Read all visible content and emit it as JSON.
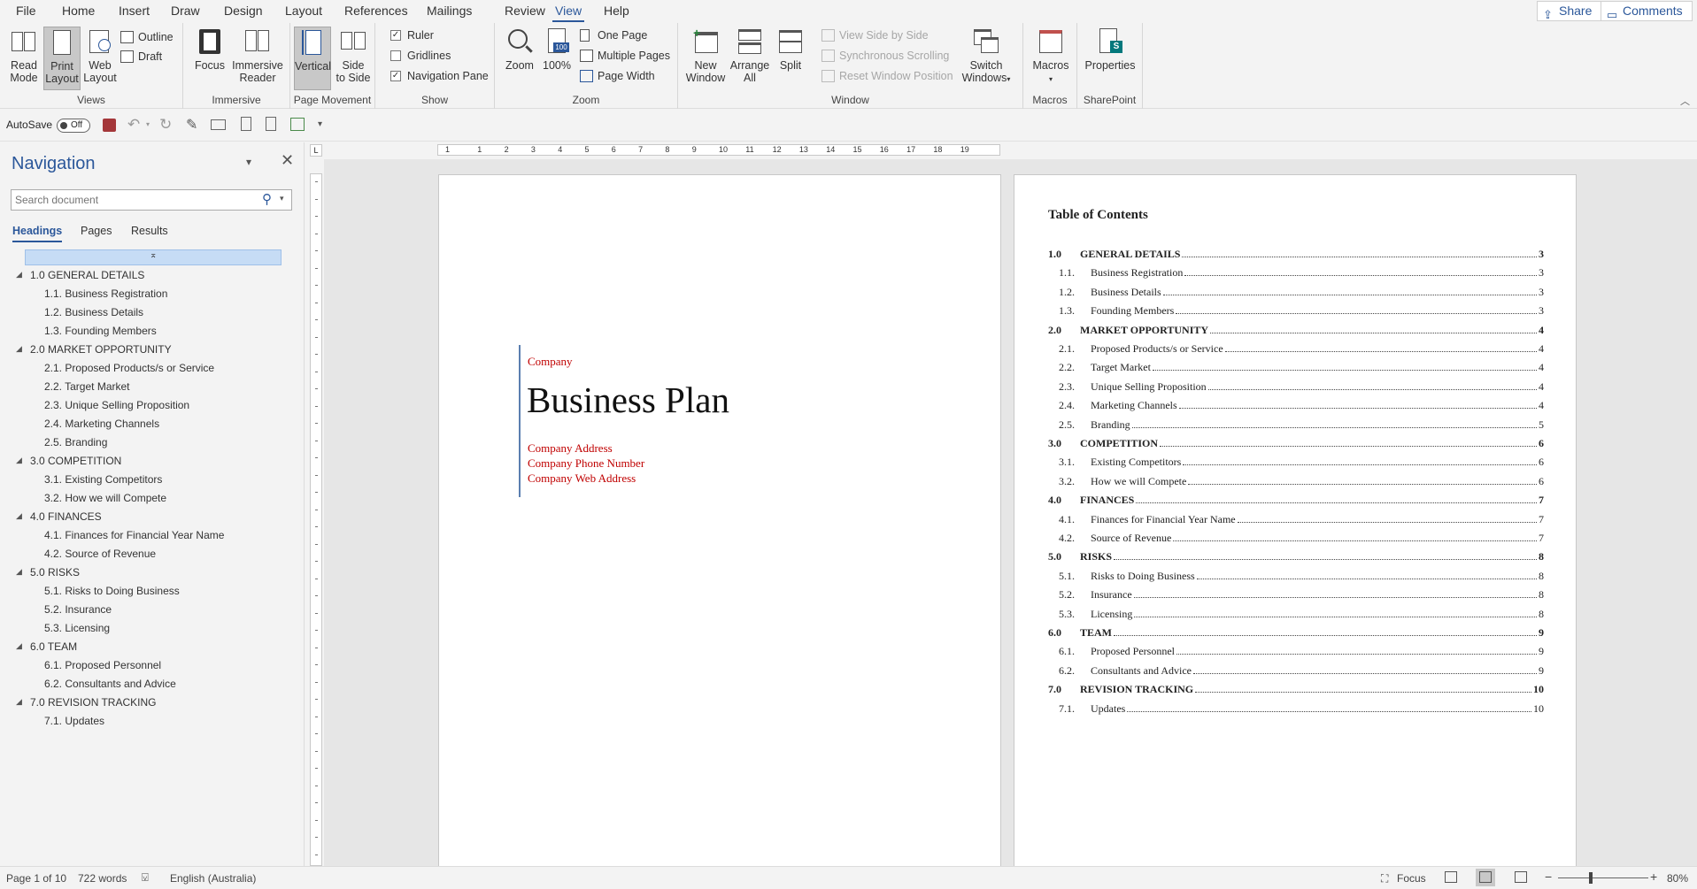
{
  "ribbon_tabs": [
    "File",
    "Home",
    "Insert",
    "Draw",
    "Design",
    "Layout",
    "References",
    "Mailings",
    "Review",
    "View",
    "Help"
  ],
  "active_tab": "View",
  "share": "Share",
  "comments": "Comments",
  "views": {
    "read": "Read\nMode",
    "print": "Print\nLayout",
    "web": "Web\nLayout",
    "outline": "Outline",
    "draft": "Draft",
    "label": "Views"
  },
  "immersive": {
    "focus": "Focus",
    "reader": "Immersive\nReader",
    "label": "Immersive"
  },
  "page_movement": {
    "vertical": "Vertical",
    "side": "Side\nto Side",
    "label": "Page Movement"
  },
  "show": {
    "ruler": "Ruler",
    "gridlines": "Gridlines",
    "nav_pane": "Navigation Pane",
    "label": "Show"
  },
  "zoom": {
    "zoom": "Zoom",
    "hundred": "100%",
    "one_page": "One Page",
    "multiple": "Multiple Pages",
    "width": "Page Width",
    "label": "Zoom"
  },
  "window": {
    "new": "New\nWindow",
    "arrange": "Arrange\nAll",
    "split": "Split",
    "side_by_side": "View Side by Side",
    "sync": "Synchronous Scrolling",
    "reset": "Reset Window Position",
    "switch": "Switch\nWindows",
    "label": "Window"
  },
  "macros": {
    "btn": "Macros",
    "label": "Macros"
  },
  "sharepoint": {
    "btn": "Properties",
    "label": "SharePoint"
  },
  "autosave": "AutoSave",
  "autosave_state": "Off",
  "nav": {
    "title": "Navigation",
    "search_placeholder": "Search document",
    "tabs": [
      "Headings",
      "Pages",
      "Results"
    ],
    "headings": [
      {
        "text": "1.0 GENERAL DETAILS",
        "level": 1
      },
      {
        "text": "1.1. Business Registration",
        "level": 2
      },
      {
        "text": "1.2. Business Details",
        "level": 2
      },
      {
        "text": "1.3. Founding Members",
        "level": 2
      },
      {
        "text": "2.0 MARKET OPPORTUNITY",
        "level": 1
      },
      {
        "text": "2.1. Proposed Products/s or Service",
        "level": 2
      },
      {
        "text": "2.2. Target Market",
        "level": 2
      },
      {
        "text": "2.3. Unique Selling Proposition",
        "level": 2
      },
      {
        "text": "2.4. Marketing Channels",
        "level": 2
      },
      {
        "text": "2.5. Branding",
        "level": 2
      },
      {
        "text": "3.0 COMPETITION",
        "level": 1
      },
      {
        "text": "3.1. Existing Competitors",
        "level": 2
      },
      {
        "text": "3.2. How we will Compete",
        "level": 2
      },
      {
        "text": "4.0 FINANCES",
        "level": 1
      },
      {
        "text": "4.1. Finances for Financial Year Name",
        "level": 2
      },
      {
        "text": "4.2. Source of Revenue",
        "level": 2
      },
      {
        "text": "5.0 RISKS",
        "level": 1
      },
      {
        "text": "5.1. Risks to Doing Business",
        "level": 2
      },
      {
        "text": "5.2. Insurance",
        "level": 2
      },
      {
        "text": "5.3. Licensing",
        "level": 2
      },
      {
        "text": "6.0 TEAM",
        "level": 1
      },
      {
        "text": "6.1. Proposed Personnel",
        "level": 2
      },
      {
        "text": "6.2. Consultants and Advice",
        "level": 2
      },
      {
        "text": "7.0 REVISION TRACKING",
        "level": 1
      },
      {
        "text": "7.1. Updates",
        "level": 2
      }
    ]
  },
  "ruler_numbers": [
    "1",
    "1",
    "2",
    "3",
    "4",
    "5",
    "6",
    "7",
    "8",
    "9",
    "10",
    "11",
    "12",
    "13",
    "14",
    "15",
    "16",
    "17",
    "18",
    "19"
  ],
  "cover": {
    "company": "Company",
    "title": "Business Plan",
    "address": "Company Address",
    "phone": "Company Phone Number",
    "web": "Company Web Address",
    "accent": "#c00000"
  },
  "toc": {
    "title": "Table of Contents",
    "entries": [
      {
        "num": "1.0",
        "text": "GENERAL DETAILS",
        "page": "3",
        "bold": true
      },
      {
        "num": "1.1.",
        "text": "Business Registration",
        "page": "3",
        "bold": false
      },
      {
        "num": "1.2.",
        "text": "Business Details",
        "page": "3",
        "bold": false
      },
      {
        "num": "1.3.",
        "text": "Founding Members",
        "page": "3",
        "bold": false
      },
      {
        "num": "2.0",
        "text": "MARKET OPPORTUNITY",
        "page": "4",
        "bold": true
      },
      {
        "num": "2.1.",
        "text": "Proposed Products/s or Service",
        "page": "4",
        "bold": false
      },
      {
        "num": "2.2.",
        "text": "Target Market",
        "page": "4",
        "bold": false
      },
      {
        "num": "2.3.",
        "text": "Unique Selling Proposition",
        "page": "4",
        "bold": false
      },
      {
        "num": "2.4.",
        "text": "Marketing Channels",
        "page": "4",
        "bold": false
      },
      {
        "num": "2.5.",
        "text": "Branding",
        "page": "5",
        "bold": false
      },
      {
        "num": "3.0",
        "text": "COMPETITION",
        "page": "6",
        "bold": true
      },
      {
        "num": "3.1.",
        "text": "Existing Competitors",
        "page": "6",
        "bold": false
      },
      {
        "num": "3.2.",
        "text": "How we will Compete",
        "page": "6",
        "bold": false
      },
      {
        "num": "4.0",
        "text": "FINANCES",
        "page": "7",
        "bold": true
      },
      {
        "num": "4.1.",
        "text": "Finances for Financial Year Name",
        "page": "7",
        "bold": false
      },
      {
        "num": "4.2.",
        "text": "Source of Revenue",
        "page": "7",
        "bold": false
      },
      {
        "num": "5.0",
        "text": "RISKS",
        "page": "8",
        "bold": true
      },
      {
        "num": "5.1.",
        "text": "Risks to Doing Business",
        "page": "8",
        "bold": false
      },
      {
        "num": "5.2.",
        "text": "Insurance",
        "page": "8",
        "bold": false
      },
      {
        "num": "5.3.",
        "text": "Licensing",
        "page": "8",
        "bold": false
      },
      {
        "num": "6.0",
        "text": "TEAM",
        "page": "9",
        "bold": true
      },
      {
        "num": "6.1.",
        "text": "Proposed Personnel",
        "page": "9",
        "bold": false
      },
      {
        "num": "6.2.",
        "text": "Consultants and Advice",
        "page": "9",
        "bold": false
      },
      {
        "num": "7.0",
        "text": "REVISION TRACKING",
        "page": "10",
        "bold": true
      },
      {
        "num": "7.1.",
        "text": "Updates",
        "page": "10",
        "bold": false
      }
    ]
  },
  "status": {
    "page": "Page 1 of 10",
    "words": "722 words",
    "lang": "English (Australia)",
    "focus": "Focus",
    "zoom": "80%"
  },
  "colors": {
    "accent_blue": "#2b579a",
    "selected_heading": "#c6dcf5"
  }
}
